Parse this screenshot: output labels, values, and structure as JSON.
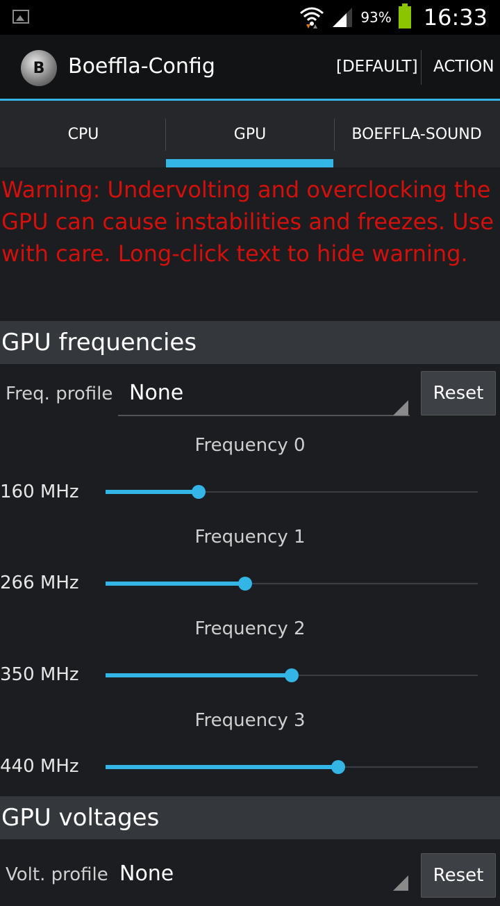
{
  "status_bar": {
    "battery_percent": "93%",
    "time": "16:33",
    "icons": [
      "image-icon",
      "wifi-icon",
      "signal-icon",
      "battery-icon"
    ]
  },
  "action_bar": {
    "title": "Boeffla-Config",
    "default_label": "[DEFAULT]",
    "action_label": "ACTION"
  },
  "tabs": [
    {
      "label": "CPU"
    },
    {
      "label": "GPU"
    },
    {
      "label": "BOEFFLA-SOUND"
    }
  ],
  "selected_tab": "GPU",
  "warning_text": "Warning: Undervolting and overclocking the GPU can cause instabilities and freezes. Use with care. Long-click text to hide warning.",
  "gpu_frequencies": {
    "header": "GPU frequencies",
    "profile_label": "Freq. profile",
    "profile_value": "None",
    "reset_label": "Reset",
    "items": [
      {
        "label": "Frequency 0",
        "value": "160 MHz",
        "level": 0.25
      },
      {
        "label": "Frequency 1",
        "value": "266 MHz",
        "level": 0.375
      },
      {
        "label": "Frequency 2",
        "value": "350 MHz",
        "level": 0.5
      },
      {
        "label": "Frequency 3",
        "value": "440 MHz",
        "level": 0.625
      }
    ]
  },
  "gpu_voltages": {
    "header": "GPU voltages",
    "profile_label": "Volt. profile",
    "profile_value": "None",
    "reset_label": "Reset"
  },
  "colors": {
    "accent": "#33b5e5",
    "warning": "#d3100b",
    "battery": "#8bc400"
  }
}
